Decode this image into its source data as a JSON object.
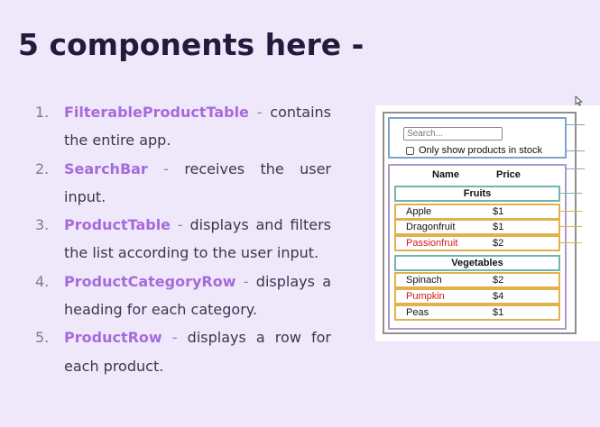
{
  "slide": {
    "title": "5 components here -"
  },
  "components": [
    {
      "number": "1.",
      "name": "FilterableProductTable",
      "separator": " - ",
      "description": "contains the entire app."
    },
    {
      "number": "2.",
      "name": "SearchBar",
      "separator": " - ",
      "description": "receives the user input."
    },
    {
      "number": "3.",
      "name": "ProductTable",
      "separator": " - ",
      "description": "displays and filters the list according to the user input."
    },
    {
      "number": "4.",
      "name": "ProductCategoryRow",
      "separator": " - ",
      "description": "displays a heading for each category."
    },
    {
      "number": "5.",
      "name": "ProductRow",
      "separator": " - ",
      "description": "displays a row for each product."
    }
  ],
  "figure": {
    "search_placeholder": "Search...",
    "checkbox_label": "Only show products in stock",
    "checkbox_checked": false,
    "column_headers": {
      "name": "Name",
      "price": "Price"
    },
    "categories": [
      {
        "title": "Fruits",
        "rows": [
          {
            "name": "Apple",
            "price": "$1",
            "in_stock": true
          },
          {
            "name": "Dragonfruit",
            "price": "$1",
            "in_stock": true
          },
          {
            "name": "Passionfruit",
            "price": "$2",
            "in_stock": false
          }
        ]
      },
      {
        "title": "Vegetables",
        "rows": [
          {
            "name": "Spinach",
            "price": "$2",
            "in_stock": true
          },
          {
            "name": "Pumpkin",
            "price": "$4",
            "in_stock": false
          },
          {
            "name": "Peas",
            "price": "$1",
            "in_stock": true
          }
        ]
      }
    ]
  },
  "colors": {
    "background": "#efe8fb",
    "title": "#241a3b",
    "component_name": "#a66bdb",
    "filterable_product_table_border": "#8f8f8f",
    "search_bar_border": "#7ea2c9",
    "product_table_border": "#ad98c8",
    "product_category_row_border": "#72b5ad",
    "product_row_border": "#e1b24b",
    "out_of_stock_text": "#d11a1a"
  },
  "icons": {
    "cursor": "mouse-pointer-icon"
  }
}
